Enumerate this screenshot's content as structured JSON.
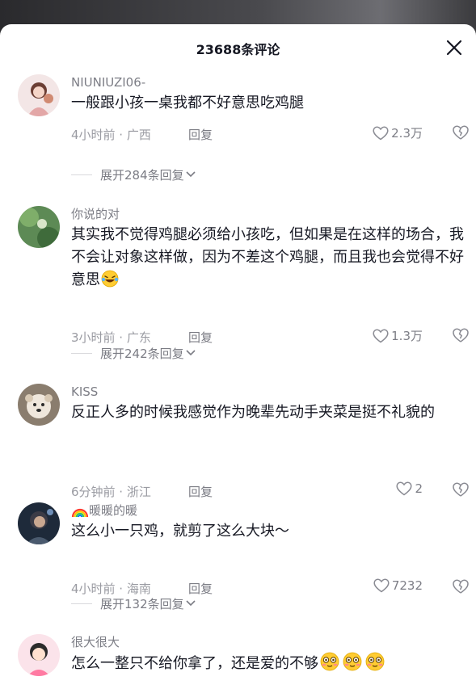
{
  "header": {
    "title": "23688条评论"
  },
  "comments": [
    {
      "user": "NIUNIUZI06-",
      "text": "一般跟小孩一桌我都不好意思吃鸡腿",
      "time": "4小时前 · 广西",
      "reply": "回复",
      "likes": "2.3万",
      "expand": "展开284条回复"
    },
    {
      "user": "你说的对",
      "text": "其实我不觉得鸡腿必须给小孩吃，但如果是在这样的场合，我不会让对象这样做，因为不差这个鸡腿，而且我也会觉得不好意思",
      "time": "3小时前 · 广东",
      "reply": "回复",
      "likes": "1.3万",
      "expand": "展开242条回复"
    },
    {
      "user": "KISS",
      "text": "反正人多的时候我感觉作为晚辈先动手夹菜是挺不礼貌的",
      "time": "6分钟前 · 浙江",
      "reply": "回复",
      "likes": "2"
    },
    {
      "user": "暖暖的暖",
      "text": "这么小一只鸡，就剪了这么大块～",
      "time": "4小时前 · 海南",
      "reply": "回复",
      "likes": "7232",
      "expand": "展开132条回复"
    },
    {
      "user": "很大很大",
      "text": "怎么一整只不给你拿了，还是爱的不够"
    }
  ],
  "icons": {
    "close": "close-icon",
    "like": "heart-outline-icon",
    "dislike": "broken-heart-icon",
    "expand": "chevron-down-icon"
  }
}
